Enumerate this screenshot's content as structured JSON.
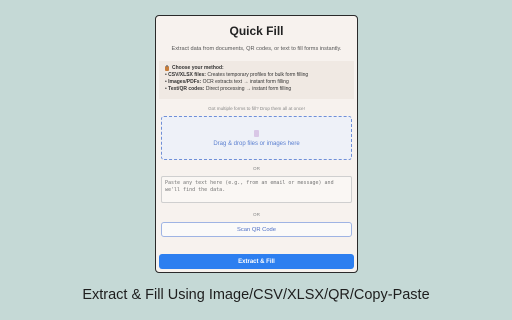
{
  "panel": {
    "title": "Quick Fill",
    "subtitle": "Extract data from documents, QR codes, or text to fill forms instantly."
  },
  "method": {
    "heading": "Choose your method:",
    "icon": "clipboard-icon",
    "rows": [
      {
        "label": "CSV/XLSX files:",
        "text": "Creates temporary profiles for bulk form filling"
      },
      {
        "label": "Images/PDFs:",
        "text": "OCR extracts text → instant form filling"
      },
      {
        "label": "Text/QR codes:",
        "text": "Direct processing → instant form filling"
      }
    ]
  },
  "multi_note": "Got multiple forms to fill? Drop them all at once!",
  "dropzone": {
    "icon": "file-icon",
    "label": "Drag & drop files or images here"
  },
  "or_label": "OR",
  "paste": {
    "placeholder": "Paste any text here (e.g., from an email or message) and we'll find the data."
  },
  "qr_button": "Scan QR Code",
  "extract_button": "Extract & Fill",
  "caption": "Extract & Fill Using Image/CSV/XLSX/QR/Copy-Paste",
  "colors": {
    "background": "#c5d9d6",
    "primary": "#2d7ff0",
    "accent": "#4e6fc5"
  }
}
